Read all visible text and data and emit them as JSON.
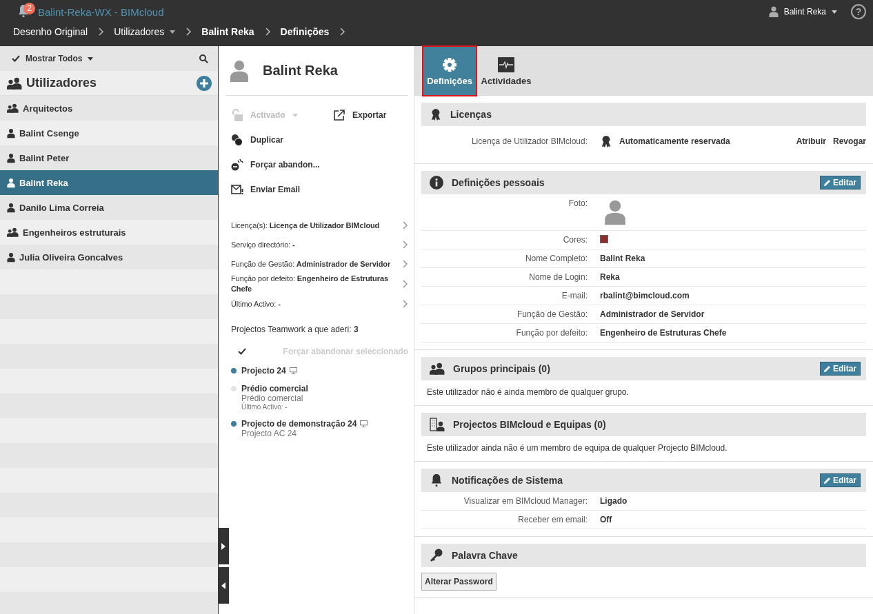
{
  "header": {
    "notification_count": "2",
    "title": "Balint-Reka-WX - BIMcloud",
    "user": "Balint Reka",
    "help": "?",
    "breadcrumbs": [
      {
        "label": "Desenho Original",
        "bold": false,
        "dropdown": false
      },
      {
        "label": "Utilizadores",
        "bold": false,
        "dropdown": true
      },
      {
        "label": "Balint Reka",
        "bold": true,
        "dropdown": false
      },
      {
        "label": "Definições",
        "bold": true,
        "dropdown": false
      }
    ]
  },
  "sidebar": {
    "filter": "Mostrar Todos",
    "heading": "Utilizadores",
    "items": [
      {
        "label": "Arquitectos",
        "kind": "group",
        "selected": false
      },
      {
        "label": "Balint Csenge",
        "kind": "user",
        "selected": false
      },
      {
        "label": "Balint Peter",
        "kind": "user",
        "selected": false
      },
      {
        "label": "Balint Reka",
        "kind": "user",
        "selected": true
      },
      {
        "label": "Danilo Lima Correia",
        "kind": "user",
        "selected": false
      },
      {
        "label": "Engenheiros estruturais",
        "kind": "group",
        "selected": false
      },
      {
        "label": "Julia Oliveira Goncalves",
        "kind": "user",
        "selected": false
      }
    ]
  },
  "details": {
    "name": "Balint Reka",
    "actions": [
      {
        "label": "Activado",
        "disabled": true
      },
      {
        "label": "Exportar",
        "disabled": false
      },
      {
        "label": "Duplicar",
        "disabled": false
      },
      {
        "label": "Forçar abandon...",
        "disabled": false
      },
      {
        "label": "Enviar Email",
        "disabled": false
      }
    ],
    "properties": [
      "Licença(s): **Licença de Utilizador BIMcloud**",
      "Serviço directório: **-**",
      "Função de Gestão: **Administrador de Servidor**",
      "Função por defeito: **Engenheiro de Estruturas Chefe**",
      "Último Activo: **-**"
    ],
    "projects_count": "Projectos Teamwork a que aderi: **3**",
    "force_leave": {
      "label": "Forçar abandonar seleccionado",
      "disabled": true
    },
    "projects": [
      {
        "name": "Projecto 24",
        "color": "#3d7f9c",
        "monitor": true
      },
      {
        "name": "Prédio comercial",
        "subtitle": "Prédio comercial",
        "last_active": "Último Activo: -",
        "color": "#e4e4e4",
        "monitor": false
      },
      {
        "name": "Projecto de demonstração 24",
        "subtitle": "Projecto AC 24",
        "color": "#3d7f9c",
        "monitor": true
      }
    ]
  },
  "tabs": [
    {
      "label": "Definições",
      "selected": true
    },
    {
      "label": "Actividades",
      "selected": false
    }
  ],
  "sections": [
    {
      "title": "Licenças",
      "kind": "license",
      "license": {
        "label": "Licença de Utilizador BIMcloud:",
        "value": "Automaticamente reservada",
        "actions": [
          "Atribuir",
          "Revogar"
        ]
      }
    },
    {
      "title": "Definições pessoais",
      "kind": "fields",
      "edit": "Editar",
      "fields": [
        {
          "label": "Foto:",
          "kind": "photo"
        },
        {
          "label": "Cores:",
          "kind": "color",
          "color": "#8e2f2f"
        },
        {
          "label": "Nome Completo:",
          "kind": "text",
          "value": "Balint Reka"
        },
        {
          "label": "Nome de Login:",
          "kind": "text",
          "value": "Reka"
        },
        {
          "label": "E-mail:",
          "kind": "text",
          "value": "rbalint@bimcloud.com"
        },
        {
          "label": "Função de Gestão:",
          "kind": "text",
          "value": "Administrador de Servidor"
        },
        {
          "label": "Função por defeito:",
          "kind": "text",
          "value": "Engenheiro de Estruturas Chefe"
        }
      ]
    },
    {
      "title": "Grupos principais (0)",
      "kind": "text",
      "edit": "Editar",
      "text": "Este utilizador não é ainda membro de qualquer grupo."
    },
    {
      "title": "Projectos BIMcloud e Equipas (0)",
      "kind": "text",
      "text": "Este utilizador ainda não é um membro de equipa de qualquer Projecto BIMcloud."
    },
    {
      "title": "Notificações de Sistema",
      "kind": "fields",
      "edit": "Editar",
      "fields": [
        {
          "label": "Visualizar em BIMcloud Manager:",
          "kind": "text",
          "value": "Ligado"
        },
        {
          "label": "Receber em email:",
          "kind": "text",
          "value": "Off"
        }
      ]
    },
    {
      "title": "Palavra Chave",
      "kind": "button",
      "button": "Alterar Password"
    }
  ]
}
